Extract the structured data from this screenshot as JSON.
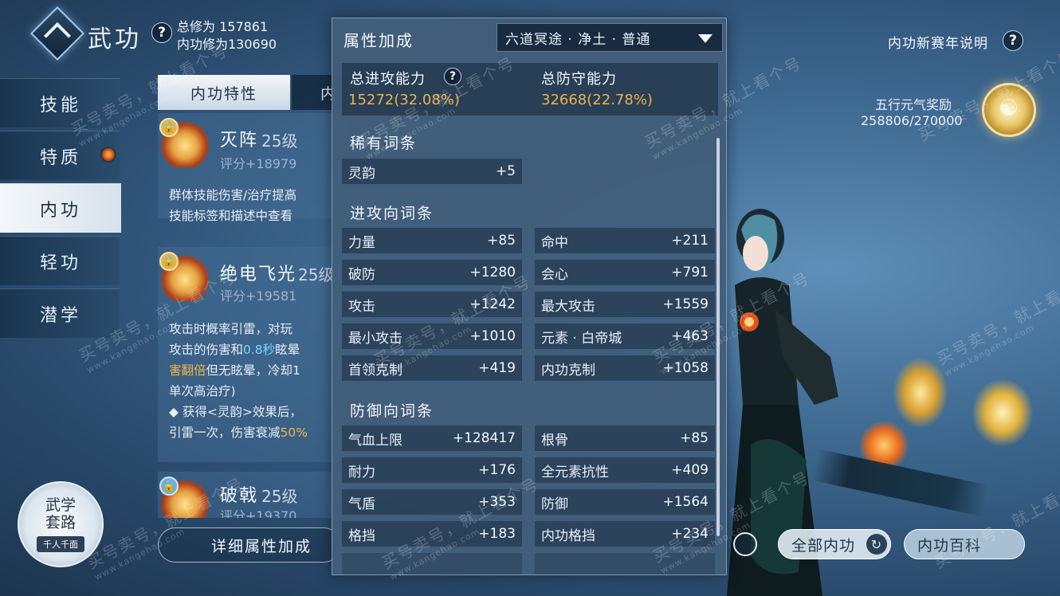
{
  "header": {
    "title": "武功",
    "total_cultivation": "总修为 157861",
    "neigong_cultivation": "内功修为130690"
  },
  "nav": {
    "items": [
      {
        "label": "技能"
      },
      {
        "label": "特质"
      },
      {
        "label": "内功"
      },
      {
        "label": "轻功"
      },
      {
        "label": "潜学"
      }
    ]
  },
  "tabs": {
    "active": "内功特性",
    "inactive": "内"
  },
  "skills": [
    {
      "name": "灭阵",
      "level": "25级",
      "score": "评分+18979",
      "desc": [
        "群体技能伤害/治疗提高",
        "技能标签和描述中查看"
      ]
    },
    {
      "name": "绝电飞光",
      "level": "25级",
      "score": "评分+19581",
      "desc_lines": {
        "l1": "攻击时概率引雷，对玩",
        "l2_a": "攻击的伤害和",
        "l2_b": "0.8秒",
        "l2_c": "眩晕",
        "l3_a": "害翻倍",
        "l3_b": "但无眩晕，冷却1",
        "l4": "单次高治疗)",
        "l5": "◆ 获得<灵韵>效果后，",
        "l6_a": "引雷一次，伤害衰减",
        "l6_b": "50%"
      }
    },
    {
      "name": "破戟",
      "level": "25级",
      "score": "评分+19370"
    }
  ],
  "detail_button": "详细属性加成",
  "wuxue": {
    "line1": "武学",
    "line2": "套路",
    "sub": "千人千面"
  },
  "popup": {
    "title": "属性加成",
    "dropdown": "六道冥途 · 净土 · 普通",
    "total_attack_label": "总进攻能力",
    "total_attack_value": "15272(32.08%)",
    "total_defense_label": "总防守能力",
    "total_defense_value": "32668(22.78%)",
    "rare_title": "稀有词条",
    "rare": [
      {
        "name": "灵韵",
        "value": "+5"
      }
    ],
    "attack_title": "进攻向词条",
    "attack": [
      {
        "name": "力量",
        "value": "+85"
      },
      {
        "name": "命中",
        "value": "+211"
      },
      {
        "name": "破防",
        "value": "+1280"
      },
      {
        "name": "会心",
        "value": "+791"
      },
      {
        "name": "攻击",
        "value": "+1242"
      },
      {
        "name": "最大攻击",
        "value": "+1559"
      },
      {
        "name": "最小攻击",
        "value": "+1010"
      },
      {
        "name": "元素 · 白帝城",
        "value": "+463"
      },
      {
        "name": "首领克制",
        "value": "+419"
      },
      {
        "name": "内功克制",
        "value": "+1058"
      }
    ],
    "defense_title": "防御向词条",
    "defense": [
      {
        "name": "气血上限",
        "value": "+128417"
      },
      {
        "name": "根骨",
        "value": "+85"
      },
      {
        "name": "耐力",
        "value": "+176"
      },
      {
        "name": "全元素抗性",
        "value": "+409"
      },
      {
        "name": "气盾",
        "value": "+353"
      },
      {
        "name": "防御",
        "value": "+1564"
      },
      {
        "name": "格挡",
        "value": "+183"
      },
      {
        "name": "内功格挡",
        "value": "+234"
      }
    ]
  },
  "right": {
    "season_label": "内功新赛年说明",
    "reward_label": "五行元气奖励",
    "reward_value": "258806/270000"
  },
  "bottom": {
    "all_neigong": "全部内功",
    "neigong_wiki": "内功百科"
  },
  "watermark": {
    "text": "买号卖号，就上看个号",
    "url": "www.kangehao.com",
    "brand": "看个号"
  },
  "colors": {
    "accent_gold": "#f0b04a",
    "highlight_blue": "#7fd1ff",
    "panel_bg": "#425e7a"
  }
}
